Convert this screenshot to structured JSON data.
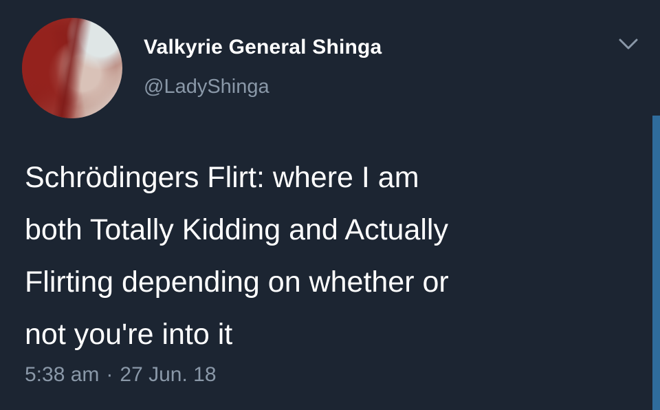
{
  "user": {
    "display_name": "Valkyrie General Shinga",
    "handle": "@LadyShinga"
  },
  "tweet": {
    "text": "Schrödingers Flirt: where I am\nboth Totally Kidding and Actually\nFlirting depending on whether or\nnot you're into it",
    "time": "5:38 am",
    "separator": "·",
    "date": "27 Jun. 18"
  },
  "icons": {
    "menu": "chevron-down-icon"
  },
  "colors": {
    "background": "#1c2532",
    "text": "#ffffff",
    "secondary_text": "#8a98a8",
    "scrollbar": "#2f6c9c"
  }
}
